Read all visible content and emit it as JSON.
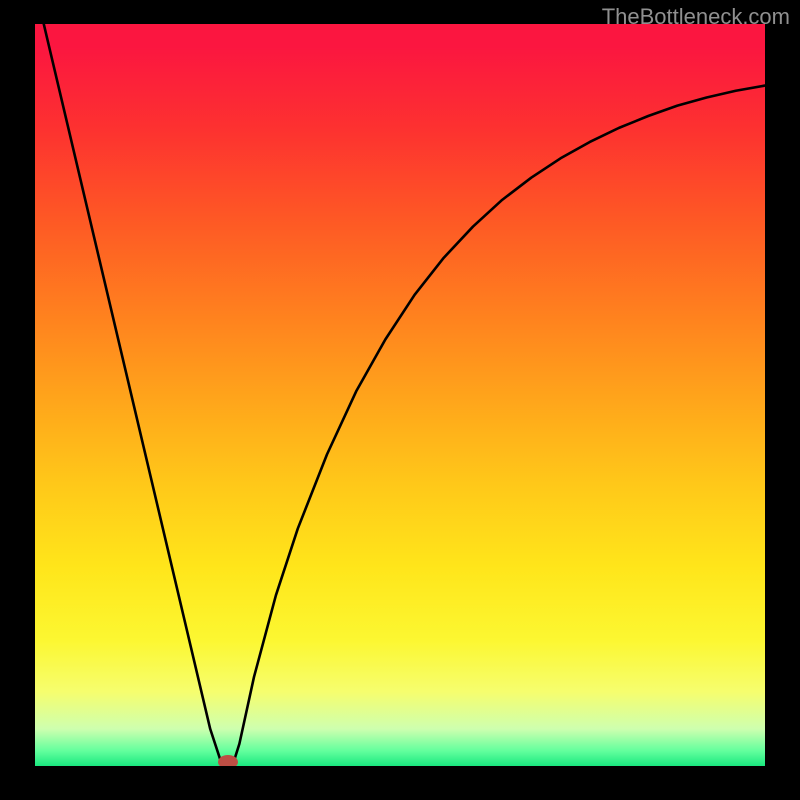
{
  "attribution": "TheBottleneck.com",
  "chart_data": {
    "type": "line",
    "title": "",
    "xlabel": "",
    "ylabel": "",
    "xlim": [
      0,
      100
    ],
    "ylim": [
      0,
      100
    ],
    "series": [
      {
        "name": "curve",
        "x": [
          0,
          3,
          6,
          9,
          12,
          15,
          18,
          21,
          24,
          25.5,
          27.2,
          28,
          30,
          33,
          36,
          40,
          44,
          48,
          52,
          56,
          60,
          64,
          68,
          72,
          76,
          80,
          84,
          88,
          92,
          96,
          100
        ],
        "values": [
          105,
          92.5,
          80.0,
          67.5,
          55.0,
          42.5,
          30.0,
          17.5,
          5.0,
          0.5,
          0.5,
          3.0,
          12.0,
          23.0,
          32.0,
          42.0,
          50.5,
          57.5,
          63.5,
          68.5,
          72.7,
          76.3,
          79.3,
          81.9,
          84.1,
          86.0,
          87.6,
          89.0,
          90.1,
          91.0,
          91.7
        ]
      }
    ],
    "marker": {
      "x": 26.5,
      "y": 0.5
    }
  }
}
